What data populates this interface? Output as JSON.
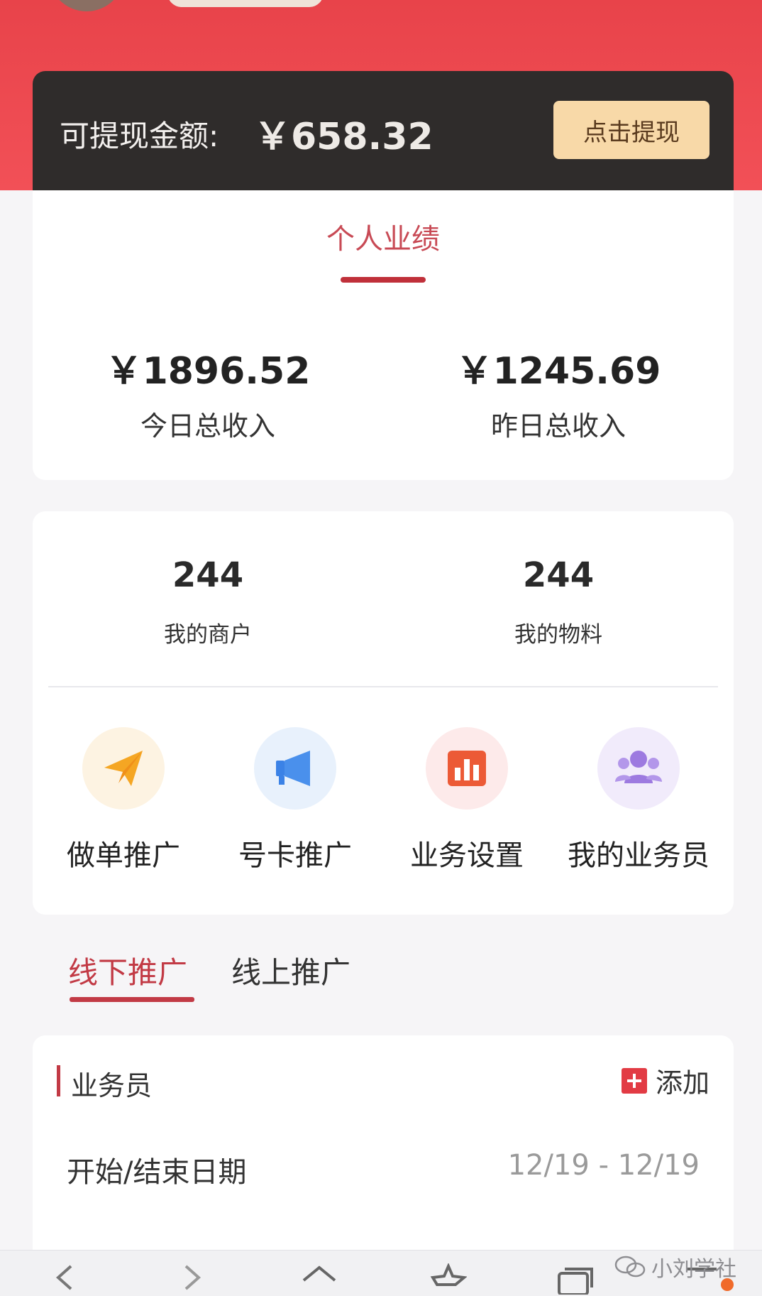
{
  "balance": {
    "label": "可提现金额:",
    "amount": "￥658.32",
    "withdraw_label": "点击提现"
  },
  "performance": {
    "title": "个人业绩",
    "today_value": "￥1896.52",
    "today_label": "今日总收入",
    "yesterday_value": "￥1245.69",
    "yesterday_label": "昨日总收入"
  },
  "counts": {
    "merchants_value": "244",
    "merchants_label": "我的商户",
    "materials_value": "244",
    "materials_label": "我的物料"
  },
  "actions": [
    {
      "label": "做单推广",
      "icon": "paper-plane-icon",
      "color": "#f5a623",
      "bg": "#fdf3e2"
    },
    {
      "label": "号卡推广",
      "icon": "megaphone-icon",
      "color": "#3b82e6",
      "bg": "#e8f1fc"
    },
    {
      "label": "业务设置",
      "icon": "bar-chart-icon",
      "color": "#ec5a36",
      "bg": "#fdeaea"
    },
    {
      "label": "我的业务员",
      "icon": "group-icon",
      "color": "#9d7ae0",
      "bg": "#f1ebfb"
    }
  ],
  "tabs": {
    "offline": "线下推广",
    "online": "线上推广"
  },
  "salesperson": {
    "title": "业务员",
    "add_label": "添加",
    "date_label": "开始/结束日期",
    "date_value": "12/19 - 12/19"
  },
  "watermark": "小刘学社",
  "colors": {
    "brand_red": "#e8434a",
    "accent": "#c23a45",
    "dark_bar": "#2f2c2b",
    "gold_button": "#f8d9a8"
  }
}
